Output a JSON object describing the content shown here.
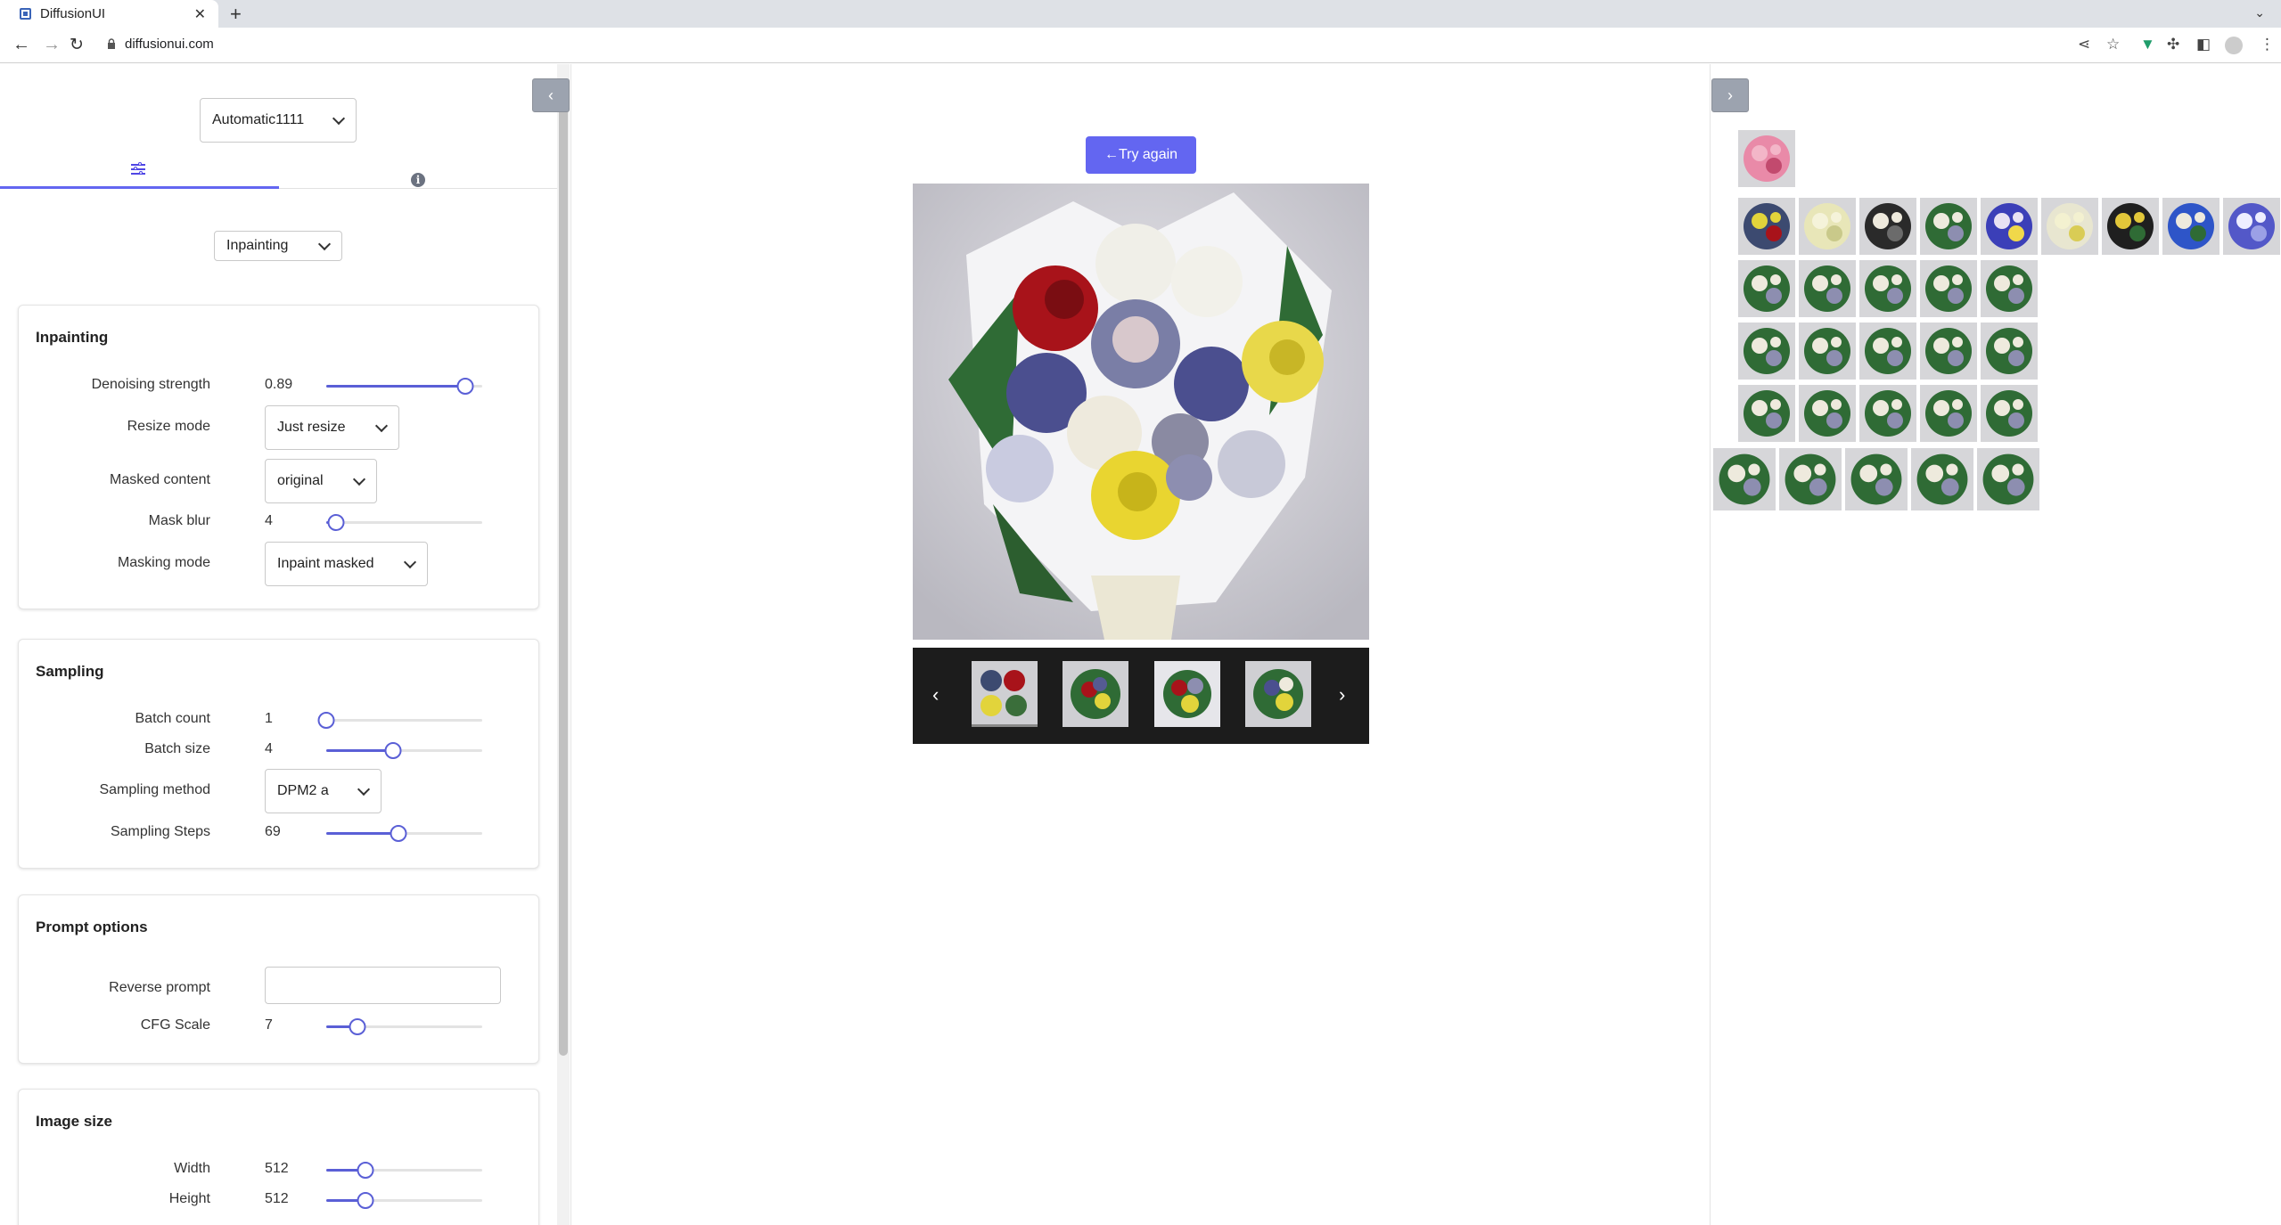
{
  "browser": {
    "tab_title": "DiffusionUI",
    "url": "diffusionui.com"
  },
  "left_panel": {
    "backend_select": "Automatic1111",
    "mode_select": "Inpainting",
    "inpainting": {
      "title": "Inpainting",
      "denoising_label": "Denoising strength",
      "denoising_value": "0.89",
      "denoising_fraction": 0.89,
      "resize_label": "Resize mode",
      "resize_value": "Just resize",
      "masked_label": "Masked content",
      "masked_value": "original",
      "blur_label": "Mask blur",
      "blur_value": "4",
      "blur_fraction": 0.06,
      "masking_label": "Masking mode",
      "masking_value": "Inpaint masked"
    },
    "sampling": {
      "title": "Sampling",
      "batch_count_label": "Batch count",
      "batch_count_value": "1",
      "batch_count_fraction": 0.0,
      "batch_size_label": "Batch size",
      "batch_size_value": "4",
      "batch_size_fraction": 0.43,
      "method_label": "Sampling method",
      "method_value": "DPM2 a",
      "steps_label": "Sampling Steps",
      "steps_value": "69",
      "steps_fraction": 0.46
    },
    "prompt_options": {
      "title": "Prompt options",
      "reverse_label": "Reverse prompt",
      "reverse_value": "",
      "cfg_label": "CFG Scale",
      "cfg_value": "7",
      "cfg_fraction": 0.2
    },
    "image_size": {
      "title": "Image size",
      "width_label": "Width",
      "width_value": "512",
      "width_fraction": 0.25,
      "height_label": "Height",
      "height_value": "512",
      "height_fraction": 0.25
    }
  },
  "center": {
    "try_again_label": "←Try again"
  },
  "icons": {
    "back": "arrow-left-icon",
    "forward": "arrow-right-icon",
    "reload": "reload-icon",
    "share": "share-icon",
    "bookmark": "star-icon",
    "extensions": "puzzle-icon",
    "profile": "profile-icon",
    "menu": "kebab-menu-icon"
  },
  "colors": {
    "accent": "#6366f1",
    "carousel_bg": "#1c1c1c"
  }
}
